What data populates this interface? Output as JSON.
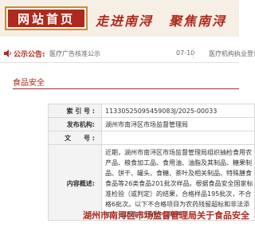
{
  "header": {
    "home_label": "网站首页",
    "slogan_1": "走进南浔",
    "slogan_2": "聚焦南浔",
    "bg_color": "#f6efe6",
    "accent_color": "#b1281c"
  },
  "notice": {
    "label": "公示公告:",
    "text": "医疗广告核准公示",
    "date": "07-10",
    "text_2": "医疗机构执业登记"
  },
  "section": {
    "title": "食品安全"
  },
  "meta": {
    "index_label": "索 引 号 :",
    "index_value": "11330525095459083J/2025-00033",
    "org_label": "发布机构:",
    "org_value": "湖州市南浔区市场监督管理局",
    "doc_label": "文　　号 :",
    "doc_value": "",
    "content_label": "内容概述:",
    "content_value": "近期，湖州市南浔区市场监督管理局组织抽检食用农产品、粮食加工品、食用油、油脂及其制品、糖果制品、饼干、罐头、食糖、茶叶及相关制品、特殊膳食食品等26类食品201批次样品。根据食品安全国家标准检验（或判定）的结果，合格样品195批次，不合格6批次。以下不合格项目为农药残留超标和非法添加。具体情况见附件（附件）"
  },
  "article": {
    "title": "湖州市南浔区市场监督管理局关于食品安全"
  }
}
